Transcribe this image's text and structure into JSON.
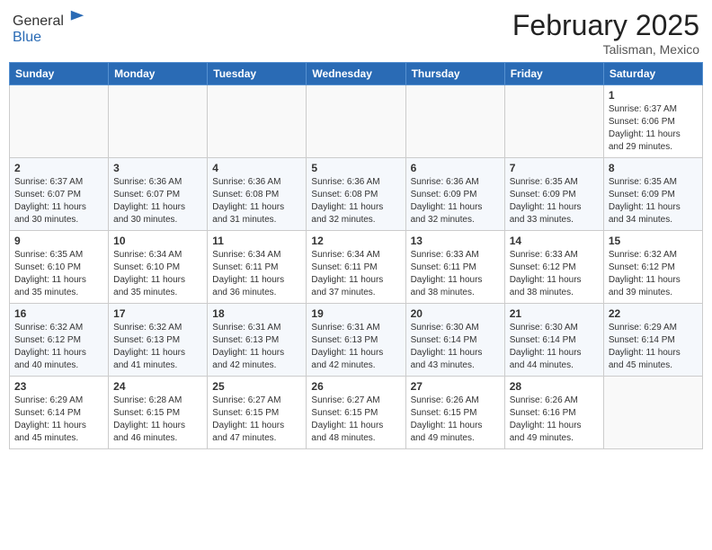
{
  "header": {
    "logo_general": "General",
    "logo_blue": "Blue",
    "month_year": "February 2025",
    "location": "Talisman, Mexico"
  },
  "days_of_week": [
    "Sunday",
    "Monday",
    "Tuesday",
    "Wednesday",
    "Thursday",
    "Friday",
    "Saturday"
  ],
  "weeks": [
    [
      {
        "day": "",
        "info": ""
      },
      {
        "day": "",
        "info": ""
      },
      {
        "day": "",
        "info": ""
      },
      {
        "day": "",
        "info": ""
      },
      {
        "day": "",
        "info": ""
      },
      {
        "day": "",
        "info": ""
      },
      {
        "day": "1",
        "info": "Sunrise: 6:37 AM\nSunset: 6:06 PM\nDaylight: 11 hours and 29 minutes."
      }
    ],
    [
      {
        "day": "2",
        "info": "Sunrise: 6:37 AM\nSunset: 6:07 PM\nDaylight: 11 hours and 30 minutes."
      },
      {
        "day": "3",
        "info": "Sunrise: 6:36 AM\nSunset: 6:07 PM\nDaylight: 11 hours and 30 minutes."
      },
      {
        "day": "4",
        "info": "Sunrise: 6:36 AM\nSunset: 6:08 PM\nDaylight: 11 hours and 31 minutes."
      },
      {
        "day": "5",
        "info": "Sunrise: 6:36 AM\nSunset: 6:08 PM\nDaylight: 11 hours and 32 minutes."
      },
      {
        "day": "6",
        "info": "Sunrise: 6:36 AM\nSunset: 6:09 PM\nDaylight: 11 hours and 32 minutes."
      },
      {
        "day": "7",
        "info": "Sunrise: 6:35 AM\nSunset: 6:09 PM\nDaylight: 11 hours and 33 minutes."
      },
      {
        "day": "8",
        "info": "Sunrise: 6:35 AM\nSunset: 6:09 PM\nDaylight: 11 hours and 34 minutes."
      }
    ],
    [
      {
        "day": "9",
        "info": "Sunrise: 6:35 AM\nSunset: 6:10 PM\nDaylight: 11 hours and 35 minutes."
      },
      {
        "day": "10",
        "info": "Sunrise: 6:34 AM\nSunset: 6:10 PM\nDaylight: 11 hours and 35 minutes."
      },
      {
        "day": "11",
        "info": "Sunrise: 6:34 AM\nSunset: 6:11 PM\nDaylight: 11 hours and 36 minutes."
      },
      {
        "day": "12",
        "info": "Sunrise: 6:34 AM\nSunset: 6:11 PM\nDaylight: 11 hours and 37 minutes."
      },
      {
        "day": "13",
        "info": "Sunrise: 6:33 AM\nSunset: 6:11 PM\nDaylight: 11 hours and 38 minutes."
      },
      {
        "day": "14",
        "info": "Sunrise: 6:33 AM\nSunset: 6:12 PM\nDaylight: 11 hours and 38 minutes."
      },
      {
        "day": "15",
        "info": "Sunrise: 6:32 AM\nSunset: 6:12 PM\nDaylight: 11 hours and 39 minutes."
      }
    ],
    [
      {
        "day": "16",
        "info": "Sunrise: 6:32 AM\nSunset: 6:12 PM\nDaylight: 11 hours and 40 minutes."
      },
      {
        "day": "17",
        "info": "Sunrise: 6:32 AM\nSunset: 6:13 PM\nDaylight: 11 hours and 41 minutes."
      },
      {
        "day": "18",
        "info": "Sunrise: 6:31 AM\nSunset: 6:13 PM\nDaylight: 11 hours and 42 minutes."
      },
      {
        "day": "19",
        "info": "Sunrise: 6:31 AM\nSunset: 6:13 PM\nDaylight: 11 hours and 42 minutes."
      },
      {
        "day": "20",
        "info": "Sunrise: 6:30 AM\nSunset: 6:14 PM\nDaylight: 11 hours and 43 minutes."
      },
      {
        "day": "21",
        "info": "Sunrise: 6:30 AM\nSunset: 6:14 PM\nDaylight: 11 hours and 44 minutes."
      },
      {
        "day": "22",
        "info": "Sunrise: 6:29 AM\nSunset: 6:14 PM\nDaylight: 11 hours and 45 minutes."
      }
    ],
    [
      {
        "day": "23",
        "info": "Sunrise: 6:29 AM\nSunset: 6:14 PM\nDaylight: 11 hours and 45 minutes."
      },
      {
        "day": "24",
        "info": "Sunrise: 6:28 AM\nSunset: 6:15 PM\nDaylight: 11 hours and 46 minutes."
      },
      {
        "day": "25",
        "info": "Sunrise: 6:27 AM\nSunset: 6:15 PM\nDaylight: 11 hours and 47 minutes."
      },
      {
        "day": "26",
        "info": "Sunrise: 6:27 AM\nSunset: 6:15 PM\nDaylight: 11 hours and 48 minutes."
      },
      {
        "day": "27",
        "info": "Sunrise: 6:26 AM\nSunset: 6:15 PM\nDaylight: 11 hours and 49 minutes."
      },
      {
        "day": "28",
        "info": "Sunrise: 6:26 AM\nSunset: 6:16 PM\nDaylight: 11 hours and 49 minutes."
      },
      {
        "day": "",
        "info": ""
      }
    ]
  ]
}
